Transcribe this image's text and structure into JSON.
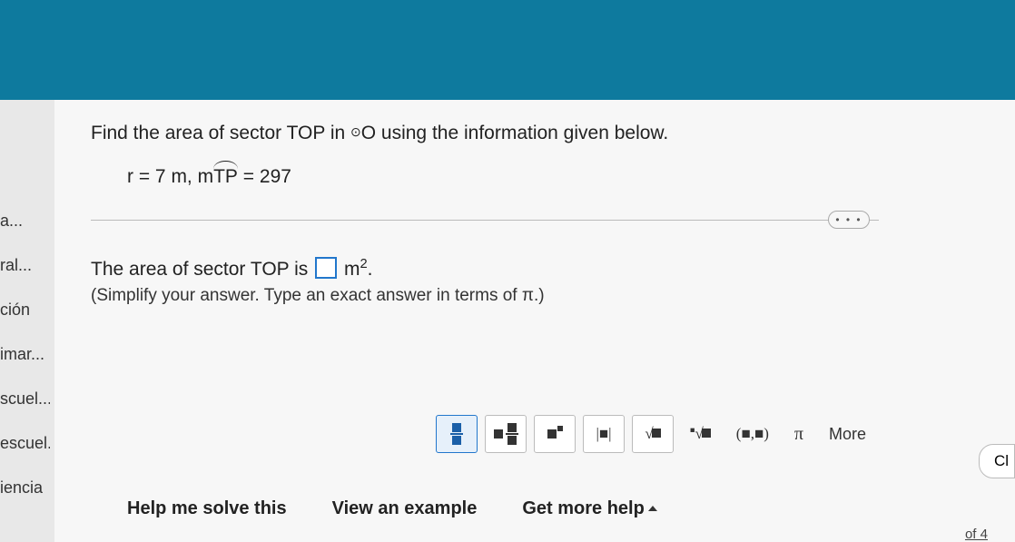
{
  "sidebar": {
    "items": [
      {
        "label": "a..."
      },
      {
        "label": "ral..."
      },
      {
        "label": "ción"
      },
      {
        "label": "imar..."
      },
      {
        "label": "scuel..."
      },
      {
        "label": "escuel..."
      },
      {
        "label": "iencia"
      }
    ]
  },
  "question": {
    "prompt_pre": "Find the area of sector TOP in ",
    "prompt_post": "O using the information given below.",
    "given_r": "r = 7 m, m",
    "given_arc": "TP",
    "given_eq": " = 297"
  },
  "answer": {
    "line_pre": "The area of sector TOP is ",
    "unit": " m",
    "unit_exp": "2",
    "unit_post": ".",
    "hint": "(Simplify your answer. Type an exact answer in terms of π.)"
  },
  "tools": {
    "abs": "|■|",
    "sqrt": "√",
    "nroot": "∛",
    "pair": "(■,■)",
    "pi": "π",
    "more": "More"
  },
  "bottom": {
    "solve": "Help me solve this",
    "example": "View an example",
    "morehelp": "Get more help"
  },
  "misc": {
    "dots": "• • •",
    "clear": "Cl",
    "footer": "of 4"
  }
}
